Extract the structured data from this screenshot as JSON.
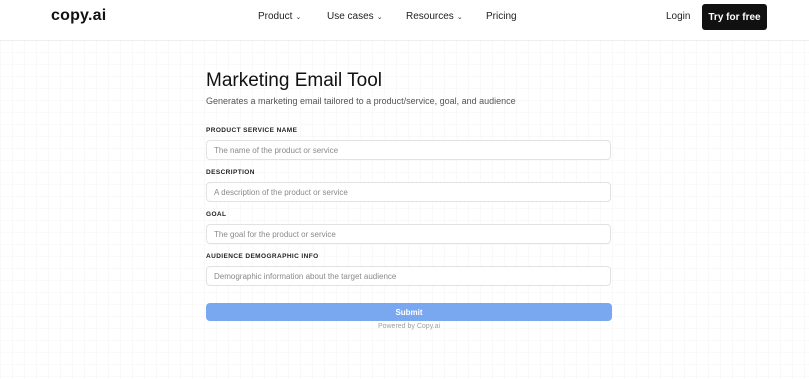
{
  "header": {
    "logo": "copy.ai",
    "nav": [
      {
        "label": "Product",
        "dropdown": true
      },
      {
        "label": "Use cases",
        "dropdown": true
      },
      {
        "label": "Resources",
        "dropdown": true
      },
      {
        "label": "Pricing",
        "dropdown": false
      }
    ],
    "login_label": "Login",
    "cta_label": "Try for free"
  },
  "main": {
    "title": "Marketing Email Tool",
    "subtitle": "Generates a marketing email tailored to a product/service, goal, and audience",
    "fields": [
      {
        "label": "PRODUCT SERVICE NAME",
        "placeholder": "The name of the product or service"
      },
      {
        "label": "DESCRIPTION",
        "placeholder": "A description of the product or service"
      },
      {
        "label": "GOAL",
        "placeholder": "The goal for the product or service"
      },
      {
        "label": "AUDIENCE DEMOGRAPHIC INFO",
        "placeholder": "Demographic information about the target audience"
      }
    ],
    "submit_label": "Submit",
    "powered_by": "Powered by Copy.ai"
  },
  "colors": {
    "submit_bg": "#7aa8f0",
    "cta_bg": "#111111"
  },
  "icons": {
    "dropdown": "chevron-down-icon"
  }
}
